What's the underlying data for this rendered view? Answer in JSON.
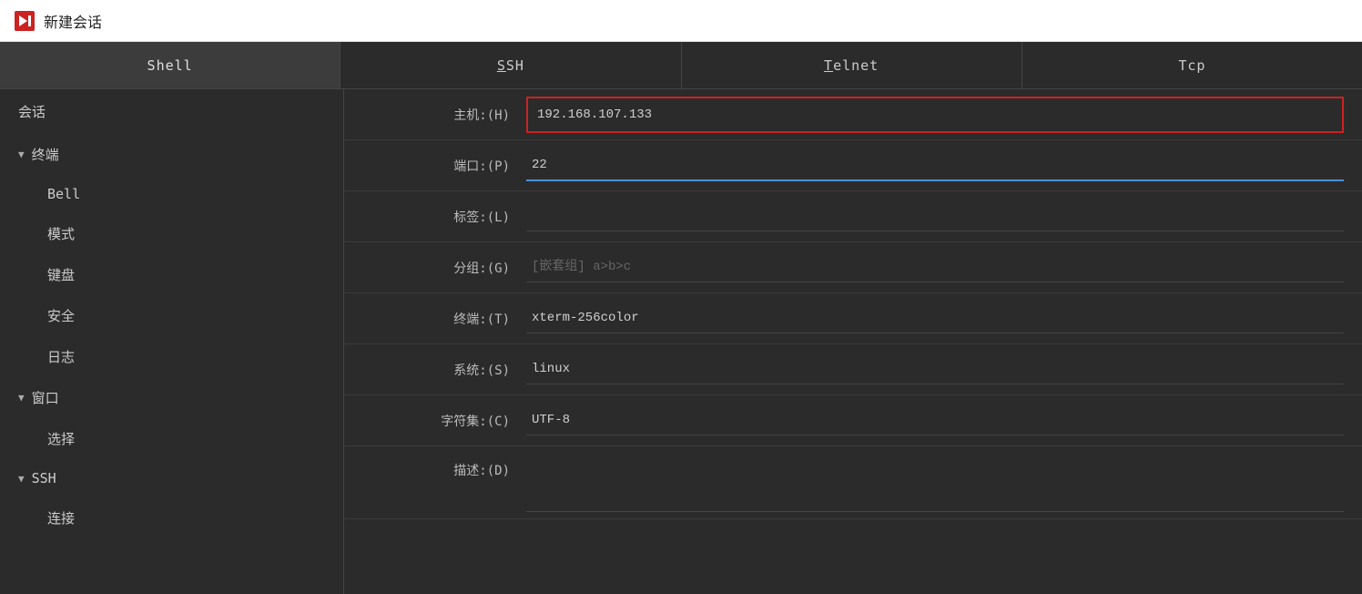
{
  "title": {
    "logo_color": "#cc2222",
    "text": "新建会话"
  },
  "tabs": [
    {
      "id": "shell",
      "label": "Shell",
      "active": true,
      "underline": false
    },
    {
      "id": "ssh",
      "label": "SSH",
      "active": false,
      "underline": true,
      "underline_char": "S"
    },
    {
      "id": "telnet",
      "label": "Telnet",
      "active": false,
      "underline": true,
      "underline_char": "T"
    },
    {
      "id": "tcp",
      "label": "Tcp",
      "active": false,
      "underline": false
    }
  ],
  "sidebar": {
    "items": [
      {
        "id": "session",
        "label": "会话",
        "type": "item",
        "depth": 0
      },
      {
        "id": "terminal-group",
        "label": "终端",
        "type": "group",
        "expanded": true,
        "depth": 0
      },
      {
        "id": "bell",
        "label": "Bell",
        "type": "child",
        "depth": 1
      },
      {
        "id": "mode",
        "label": "模式",
        "type": "child",
        "depth": 1
      },
      {
        "id": "keyboard",
        "label": "键盘",
        "type": "child",
        "depth": 1
      },
      {
        "id": "security",
        "label": "安全",
        "type": "child",
        "depth": 1
      },
      {
        "id": "log",
        "label": "日志",
        "type": "child",
        "depth": 1
      },
      {
        "id": "window-group",
        "label": "窗口",
        "type": "group",
        "expanded": true,
        "depth": 0
      },
      {
        "id": "select",
        "label": "选择",
        "type": "child",
        "depth": 1
      },
      {
        "id": "ssh-group",
        "label": "SSH",
        "type": "group",
        "expanded": true,
        "depth": 0
      },
      {
        "id": "connect",
        "label": "连接",
        "type": "child",
        "depth": 1
      }
    ]
  },
  "form": {
    "fields": [
      {
        "id": "host",
        "label": "主机:(H)",
        "value": "192.168.107.133",
        "placeholder": "",
        "state": "host-focused"
      },
      {
        "id": "port",
        "label": "端口:(P)",
        "value": "22",
        "placeholder": "",
        "state": "port-focused"
      },
      {
        "id": "label",
        "label": "标签:(L)",
        "value": "",
        "placeholder": "",
        "state": "plain"
      },
      {
        "id": "group",
        "label": "分组:(G)",
        "value": "",
        "placeholder": "[嵌套组] a>b>c",
        "state": "plain"
      },
      {
        "id": "terminal",
        "label": "终端:(T)",
        "value": "xterm-256color",
        "placeholder": "",
        "state": "plain"
      },
      {
        "id": "system",
        "label": "系统:(S)",
        "value": "linux",
        "placeholder": "",
        "state": "plain"
      },
      {
        "id": "charset",
        "label": "字符集:(C)",
        "value": "UTF-8",
        "placeholder": "",
        "state": "plain"
      },
      {
        "id": "description",
        "label": "描述:(D)",
        "value": "",
        "placeholder": "",
        "state": "plain"
      }
    ]
  },
  "colors": {
    "active_tab_bg": "#3c3c3c",
    "host_border": "#cc2222",
    "port_border": "#4a90d9",
    "bg_main": "#2b2b2b"
  }
}
